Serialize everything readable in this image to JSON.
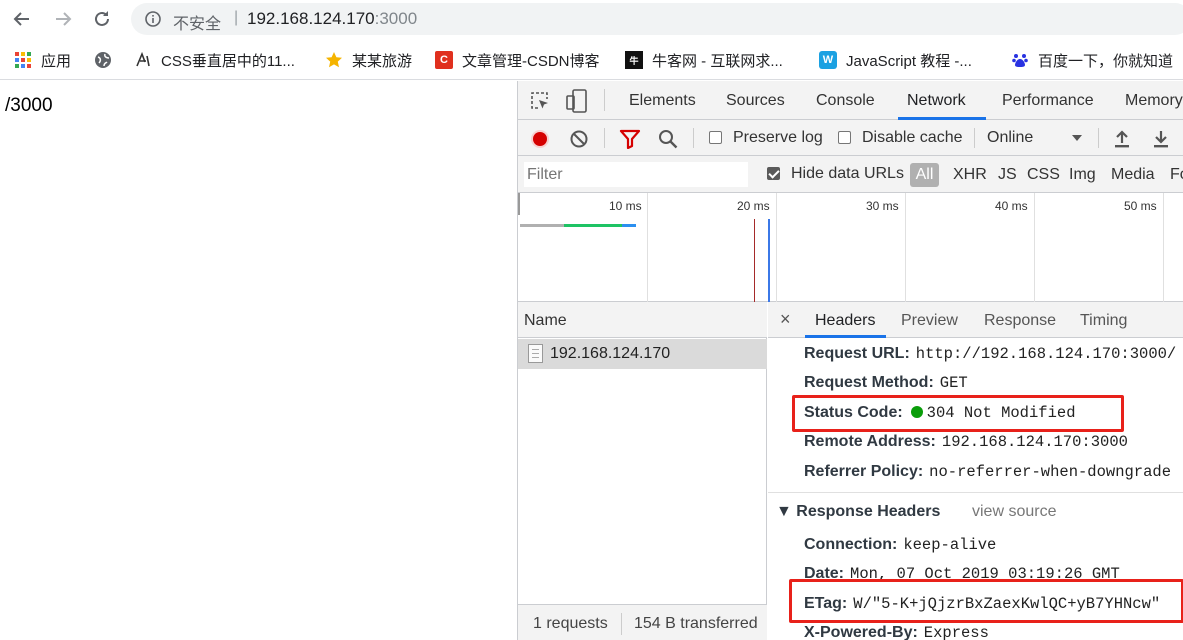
{
  "browser": {
    "insecure_label": "不安全",
    "separator": "|",
    "url_host": "192.168.124.170",
    "url_port": ":3000"
  },
  "bookmarks": [
    {
      "label": "应用",
      "icon": "apps-grid-icon"
    },
    {
      "label": "",
      "icon": "globe-icon"
    },
    {
      "label": "CSS垂直居中的11...",
      "icon": "css-site-icon"
    },
    {
      "label": "某某旅游",
      "icon": "star-icon"
    },
    {
      "label": "文章管理-CSDN博客",
      "icon": "csdn-icon"
    },
    {
      "label": "牛客网 - 互联网求...",
      "icon": "nowcoder-icon"
    },
    {
      "label": "JavaScript 教程 -...",
      "icon": "w3-icon"
    },
    {
      "label": "百度一下，你就知道",
      "icon": "baidu-paw-icon"
    }
  ],
  "page": {
    "body_text": "/3000"
  },
  "devtools": {
    "tabs": [
      "Elements",
      "Sources",
      "Console",
      "Network",
      "Performance",
      "Memory"
    ],
    "active_tab": "Network",
    "network_toolbar": {
      "preserve_log": "Preserve log",
      "disable_cache": "Disable cache",
      "throttle": "Online"
    },
    "filter_bar": {
      "placeholder": "Filter",
      "hide_data_urls": "Hide data URLs",
      "types": [
        "All",
        "XHR",
        "JS",
        "CSS",
        "Img",
        "Media",
        "Fo"
      ]
    },
    "timeline_ticks": [
      "10 ms",
      "20 ms",
      "30 ms",
      "40 ms",
      "50 ms"
    ],
    "requests": {
      "column_name": "Name",
      "rows": [
        "192.168.124.170"
      ],
      "footer_requests": "1 requests",
      "footer_transferred": "154 B transferred"
    },
    "details": {
      "close": "×",
      "tabs": [
        "Headers",
        "Preview",
        "Response",
        "Timing"
      ],
      "general": [
        {
          "key": "Request URL:",
          "value": "http://192.168.124.170:3000/"
        },
        {
          "key": "Request Method:",
          "value": "GET"
        },
        {
          "key": "Status Code:",
          "value": "304 Not Modified"
        },
        {
          "key": "Remote Address:",
          "value": "192.168.124.170:3000"
        },
        {
          "key": "Referrer Policy:",
          "value": "no-referrer-when-downgrade"
        }
      ],
      "response_headers_title": "▼ Response Headers",
      "view_source": "view source",
      "response_headers": [
        {
          "key": "Connection:",
          "value": "keep-alive"
        },
        {
          "key": "Date:",
          "value": "Mon, 07 Oct 2019 03:19:26 GMT"
        },
        {
          "key": "ETag:",
          "value": "W/\"5-K+jQjzrBxZaexKwlQC+yB7YHNcw\""
        },
        {
          "key": "X-Powered-By:",
          "value": "Express"
        }
      ]
    },
    "colors": {
      "record": "#d50000",
      "filter_icon": "#d50000",
      "status_dot": "#0a9d0a",
      "highlight_box": "#e8211a",
      "active_tab_underline": "#1a73e8"
    }
  }
}
